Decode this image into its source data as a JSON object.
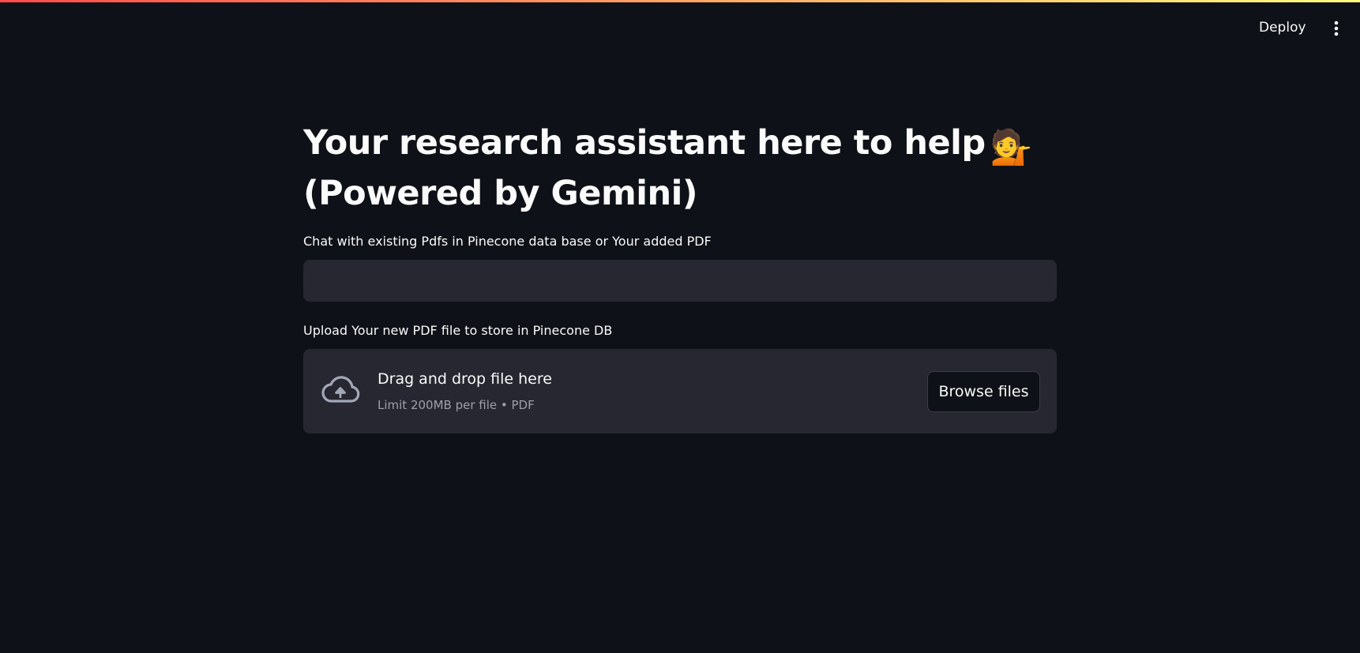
{
  "header": {
    "deploy_label": "Deploy",
    "menu_icon": "vertical-dots-icon"
  },
  "main": {
    "title_line1": "Your research assistant here to help",
    "title_emoji": "💁",
    "title_line2": "(Powered by Gemini)",
    "chat_label": "Chat with existing Pdfs in Pinecone data base or Your added PDF",
    "chat_input_value": "",
    "upload_label": "Upload Your new PDF file to store in Pinecone DB",
    "dropzone": {
      "title": "Drag and drop file here",
      "limit": "Limit 200MB per file • PDF",
      "icon": "cloud-upload-icon",
      "browse_label": "Browse files"
    }
  },
  "colors": {
    "background": "#0e1117",
    "surface": "#262730",
    "accent_gradient_start": "#ff4b4b",
    "accent_gradient_end": "#fffd80",
    "text": "#fafafa",
    "muted_text": "#9ea0a8"
  }
}
